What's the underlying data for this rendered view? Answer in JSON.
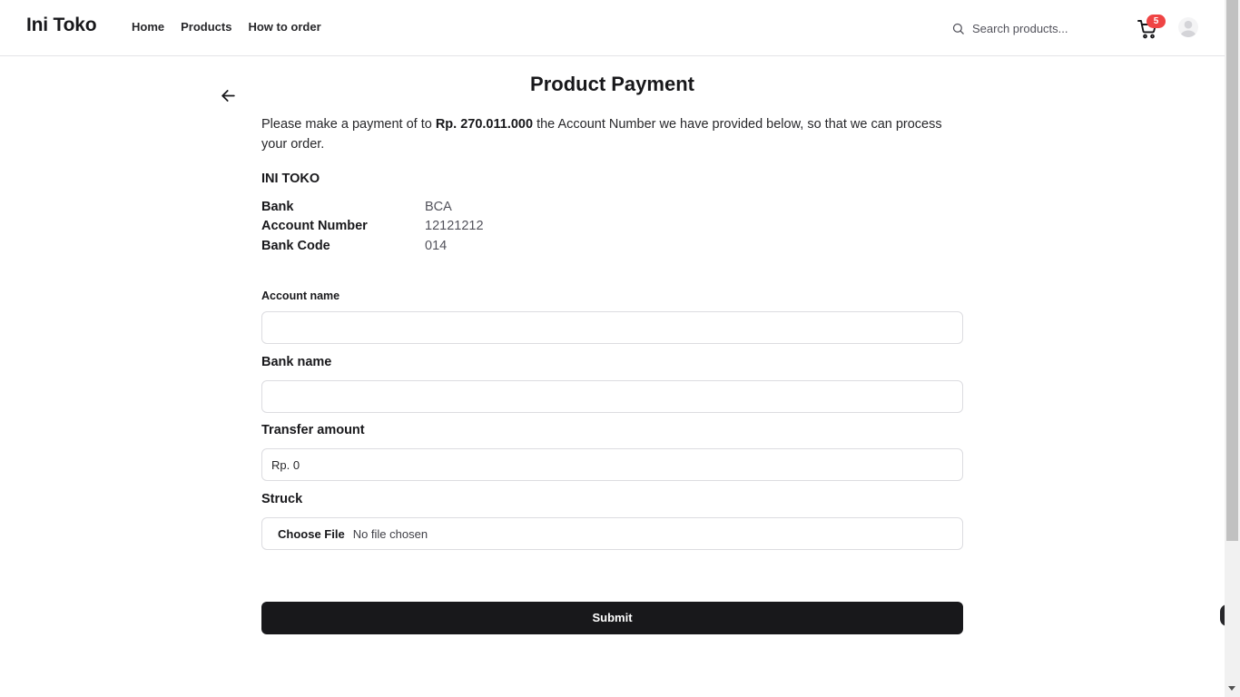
{
  "header": {
    "brand": "Ini Toko",
    "nav": [
      "Home",
      "Products",
      "How to order"
    ],
    "search_placeholder": "Search products...",
    "cart_count": "5"
  },
  "page": {
    "title": "Product Payment",
    "intro_before": "Please make a payment of to ",
    "amount": "Rp. 270.011.000",
    "intro_after": " the Account Number we have provided below, so that we can process your order.",
    "store_name": "INI TOKO",
    "account_info": [
      {
        "label": "Bank",
        "value": "BCA"
      },
      {
        "label": "Account Number",
        "value": "12121212"
      },
      {
        "label": "Bank Code",
        "value": "014"
      }
    ]
  },
  "form": {
    "account_name_label": "Account name",
    "account_name_value": "",
    "bank_name_label": "Bank name",
    "bank_name_value": "",
    "transfer_amount_label": "Transfer amount",
    "transfer_amount_value": "Rp. 0",
    "struck_label": "Struck",
    "choose_file_label": "Choose File",
    "file_status": "No file chosen",
    "submit_label": "Submit"
  },
  "colors": {
    "primary": "#18181b",
    "badge": "#ef4444",
    "border": "#dcdce0"
  },
  "icons": [
    "search-icon",
    "cart-icon",
    "user-avatar-icon",
    "arrow-left-icon"
  ]
}
